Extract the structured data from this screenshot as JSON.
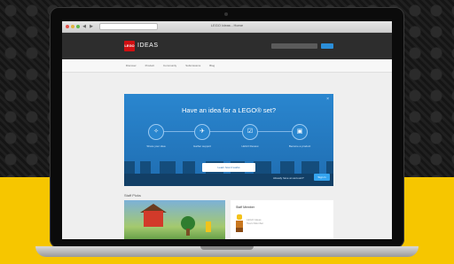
{
  "browser": {
    "tab_title": "LEGO Ideas - Home"
  },
  "site": {
    "logo_text": "LEGO",
    "brand_name": "IDEAS",
    "nav": [
      "Discover",
      "Product",
      "Community",
      "Submissions",
      "Blog"
    ]
  },
  "hero": {
    "title": "Have an idea for a LEGO® set?",
    "close_symbol": "×",
    "steps": [
      {
        "label": "Share your idea",
        "icon": "lightbulb-icon",
        "glyph": "✧"
      },
      {
        "label": "Gather support",
        "icon": "car-icon",
        "glyph": "✈"
      },
      {
        "label": "LEGO Review",
        "icon": "checklist-icon",
        "glyph": "☑"
      },
      {
        "label": "Become a product",
        "icon": "box-icon",
        "glyph": "▣"
      }
    ],
    "cta_label": "Learn how it works",
    "signin_text": "Already have an account?",
    "signin_button": "Sign in"
  },
  "content": {
    "section_title": "Staff Picks",
    "staff_card_title": "Staff Member",
    "staff_meta": [
      "LEGO Ideas",
      "Team Member"
    ]
  },
  "colors": {
    "brand_red": "#d01012",
    "hero_blue": "#2a86cf",
    "accent_blue": "#34a4f0",
    "yellow_background": "#f6c600"
  }
}
